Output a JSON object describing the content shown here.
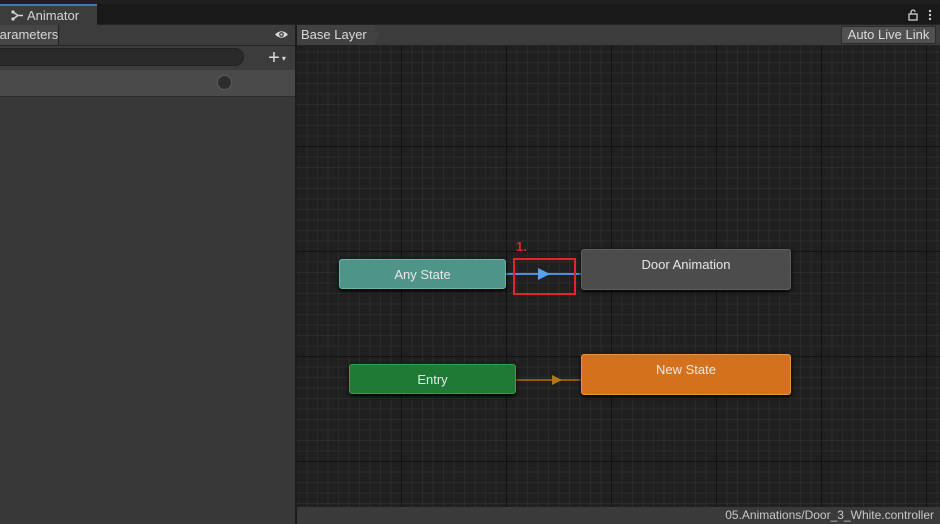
{
  "window": {
    "tab_title": "Animator",
    "tab_icon": "animator-icon",
    "lock_icon": "lock-icon",
    "menu_icon": "kebab-menu-icon"
  },
  "left_panel": {
    "tab_label": "Parameters",
    "eye_icon": "eye-icon",
    "search": {
      "value": "",
      "placeholder": ""
    },
    "add_label": "+",
    "add_caret": "▾"
  },
  "graph": {
    "breadcrumb": "Base Layer",
    "live_link_label": "Auto Live Link",
    "nodes": {
      "any_state": "Any State",
      "entry": "Entry",
      "door_animation": "Door Animation",
      "new_state": "New State"
    },
    "annotation_label": "1.",
    "colors": {
      "any_state": "#4f9488",
      "entry": "#1e7a35",
      "default_state": "#d4711d",
      "state": "#4c4c4c",
      "selected_transition": "#4a8fe2",
      "entry_transition": "#a06a12",
      "annotation": "#e0262b"
    }
  },
  "status": {
    "controller_path": "05.Animations/Door_3_White.controller"
  }
}
